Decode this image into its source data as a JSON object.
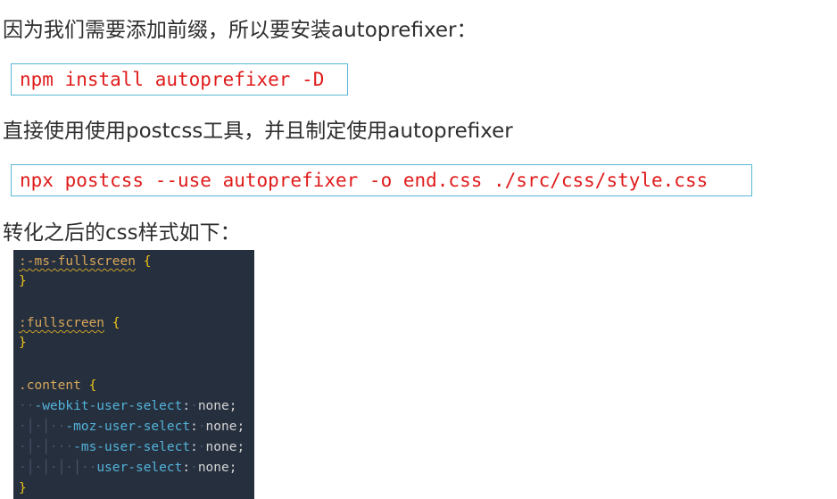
{
  "paragraphs": {
    "p1": "因为我们需要添加前缀，所以要安装autoprefixer：",
    "p2": "直接使用使用postcss工具，并且制定使用autoprefixer",
    "p3": "转化之后的css样式如下："
  },
  "commands": {
    "install": "npm install autoprefixer -D",
    "run": "npx postcss --use autoprefixer -o end.css ./src/css/style.css"
  },
  "code": {
    "l1_sel": ":-ms-fullscreen",
    "open_brace": "{",
    "close_brace": "}",
    "l4_sel": ":fullscreen",
    "l7_sel": ".content",
    "webkit_prop": "-webkit-user-select",
    "moz_prop": "-moz-user-select",
    "ms_prop": "-ms-user-select",
    "std_prop": "user-select",
    "colon": ":",
    "value": "none;"
  },
  "colors": {
    "command_text": "#e01b1b",
    "command_border": "#5ab7d6",
    "editor_bg": "#262f3e",
    "selector": "#d8a85a",
    "brace": "#f0c419",
    "property": "#53b3d9"
  }
}
